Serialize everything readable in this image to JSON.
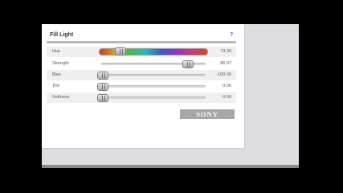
{
  "panel": {
    "title": "Fill Light",
    "help_label": "?"
  },
  "sliders": [
    {
      "id": "hue",
      "label": "Hue",
      "value": "73.30"
    },
    {
      "id": "strength",
      "label": "Strength",
      "value": "86.97"
    },
    {
      "id": "bias",
      "label": "Bias",
      "value": "-100.00"
    },
    {
      "id": "tint",
      "label": "Tint",
      "value": "0.00"
    },
    {
      "id": "softness",
      "label": "Softness",
      "value": "0.00"
    }
  ],
  "brand": {
    "logo_text": "SONY"
  },
  "colors": {
    "panel": "#ffffff",
    "background": "#dedee2",
    "accent": "#4a78c8"
  }
}
